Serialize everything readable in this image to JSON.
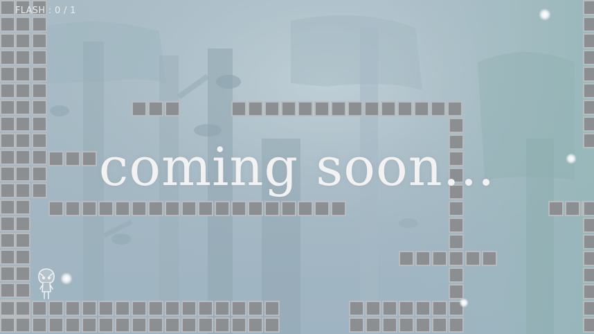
{
  "hud": {
    "flash_label": "FLASH : 0 / 1"
  },
  "overlay": {
    "message": "coming soon..."
  },
  "colors": {
    "tile_fill": "#8c8f92",
    "tile_border": "#b9bcbf",
    "background": "#a4b8c3",
    "text": "#f2f2f2"
  },
  "icons": {
    "player": "chibi-character-icon",
    "orb": "light-orb-icon"
  }
}
